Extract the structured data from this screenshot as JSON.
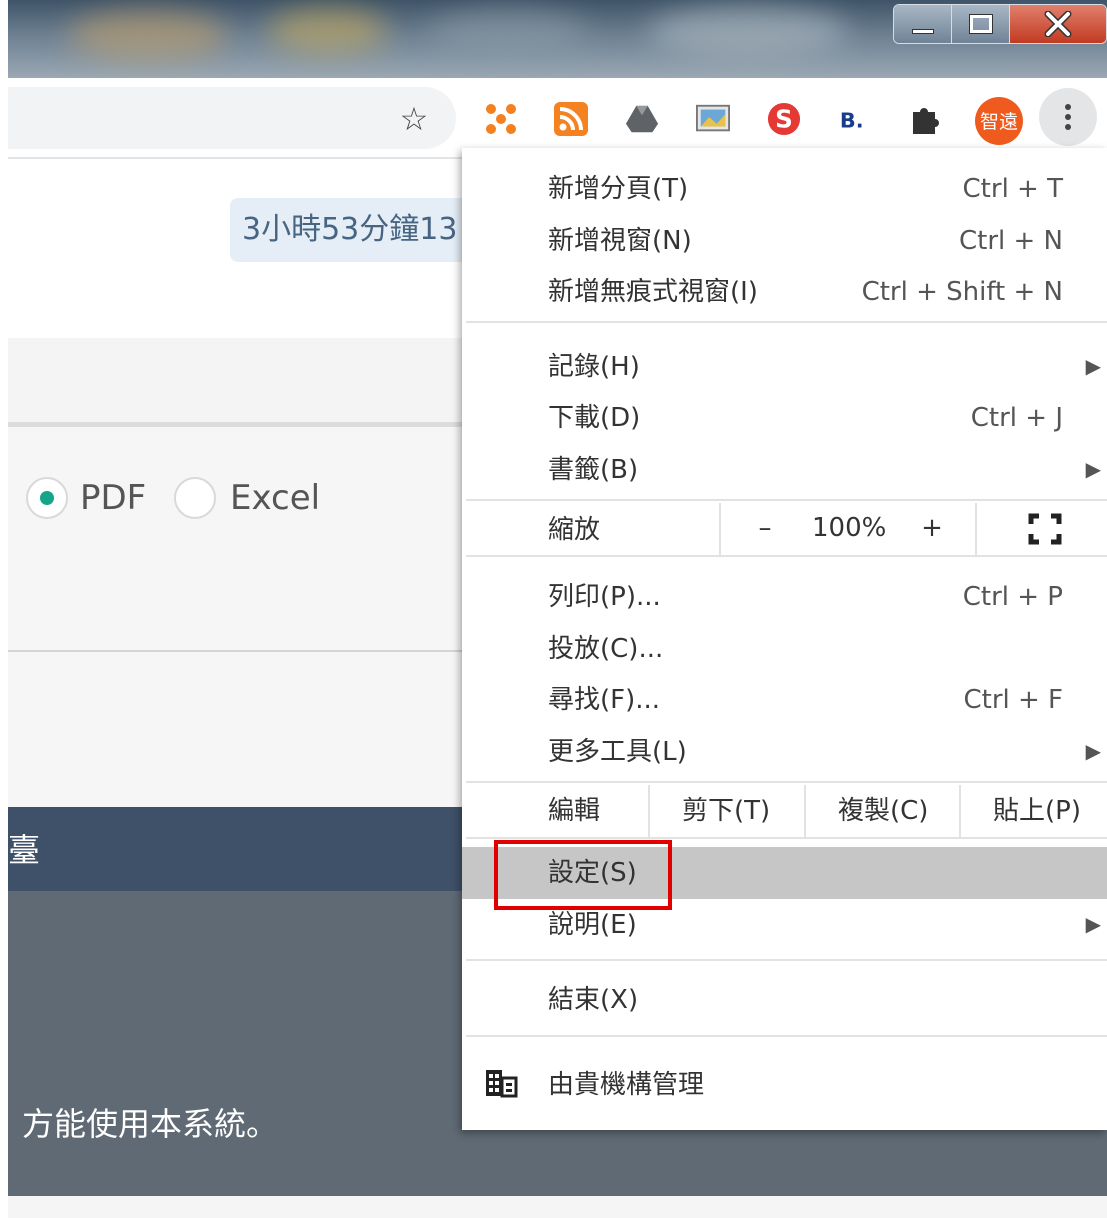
{
  "window": {
    "controls": {
      "minimize_icon": "minimize-icon",
      "maximize_icon": "restore-icon",
      "close_label": "X"
    }
  },
  "toolbar": {
    "bookmark_icon": "star-icon",
    "extensions": [
      {
        "name": "dots-extension-icon",
        "color": "#f4801f"
      },
      {
        "name": "rss-extension-icon",
        "color": "#f58220"
      },
      {
        "name": "drive-extension-icon",
        "color": "#5f6368"
      },
      {
        "name": "image-extension-icon",
        "color": "#e8c24a"
      },
      {
        "name": "s-extension-icon",
        "color": "#e53935",
        "text": "S"
      },
      {
        "name": "b-extension-icon",
        "color": "#1a3c8c",
        "text": "B."
      },
      {
        "name": "puzzle-extension-icon",
        "color": "#333333"
      },
      {
        "name": "profile-avatar",
        "color": "#ef5a1f",
        "text": "智遠"
      }
    ],
    "menu_icon": "more-vert-icon"
  },
  "page": {
    "timer_text": "3小時53分鐘13",
    "format_options": [
      {
        "label": "PDF",
        "selected": true
      },
      {
        "label": "Excel",
        "selected": false
      }
    ],
    "header_text": "臺",
    "notice_text": "方能使用本系統。",
    "accent_color": "#17a589",
    "header_color": "#3e5168"
  },
  "menu": {
    "new_tab": {
      "label": "新增分頁(T)",
      "shortcut": "Ctrl + T"
    },
    "new_window": {
      "label": "新增視窗(N)",
      "shortcut": "Ctrl + N"
    },
    "new_incognito": {
      "label": "新增無痕式視窗(I)",
      "shortcut": "Ctrl + Shift + N"
    },
    "history": {
      "label": "記錄(H)"
    },
    "downloads": {
      "label": "下載(D)",
      "shortcut": "Ctrl + J"
    },
    "bookmarks": {
      "label": "書籤(B)"
    },
    "zoom": {
      "label": "縮放",
      "minus": "–",
      "value": "100%",
      "plus": "+"
    },
    "print": {
      "label": "列印(P)...",
      "shortcut": "Ctrl + P"
    },
    "cast": {
      "label": "投放(C)..."
    },
    "find": {
      "label": "尋找(F)...",
      "shortcut": "Ctrl + F"
    },
    "more_tools": {
      "label": "更多工具(L)"
    },
    "edit": {
      "label": "編輯",
      "cut": "剪下(T)",
      "copy": "複製(C)",
      "paste": "貼上(P)"
    },
    "settings": {
      "label": "設定(S)"
    },
    "help": {
      "label": "說明(E)"
    },
    "exit": {
      "label": "結束(X)"
    },
    "managed": {
      "label": "由貴機構管理"
    },
    "highlight_color": "#e00000"
  }
}
